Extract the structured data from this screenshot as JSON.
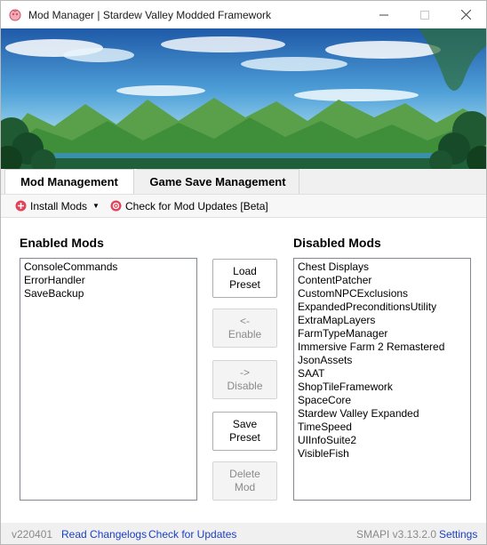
{
  "window": {
    "title": "Mod Manager | Stardew Valley Modded Framework"
  },
  "tabs": [
    {
      "label": "Mod Management",
      "active": true
    },
    {
      "label": "Game Save Management",
      "active": false
    }
  ],
  "toolbar": {
    "install_label": "Install Mods",
    "check_label": "Check for Mod Updates [Beta]"
  },
  "enabled": {
    "heading": "Enabled Mods",
    "items": [
      "ConsoleCommands",
      "ErrorHandler",
      "SaveBackup"
    ]
  },
  "disabled": {
    "heading": "Disabled Mods",
    "items": [
      "Chest Displays",
      "ContentPatcher",
      "CustomNPCExclusions",
      "ExpandedPreconditionsUtility",
      "ExtraMapLayers",
      "FarmTypeManager",
      "Immersive Farm 2 Remastered",
      "JsonAssets",
      "SAAT",
      "ShopTileFramework",
      "SpaceCore",
      "Stardew Valley Expanded",
      "TimeSpeed",
      "UIInfoSuite2",
      "VisibleFish"
    ]
  },
  "actions": {
    "load_preset": "Load\nPreset",
    "enable": "<-\nEnable",
    "disable": "->\nDisable",
    "save_preset": "Save\nPreset",
    "delete_mod": "Delete\nMod"
  },
  "statusbar": {
    "version": "v220401",
    "read_changelogs": "Read Changelogs",
    "check_updates": "Check for Updates",
    "smapi": "SMAPI v3.13.2.0",
    "settings": "Settings"
  },
  "colors": {
    "link": "#1a3fc4",
    "sky_top": "#1f5aa8",
    "sky_bottom": "#c5ecf5",
    "mountain": "#3f8f3a",
    "trees": "#1f5f3a"
  }
}
